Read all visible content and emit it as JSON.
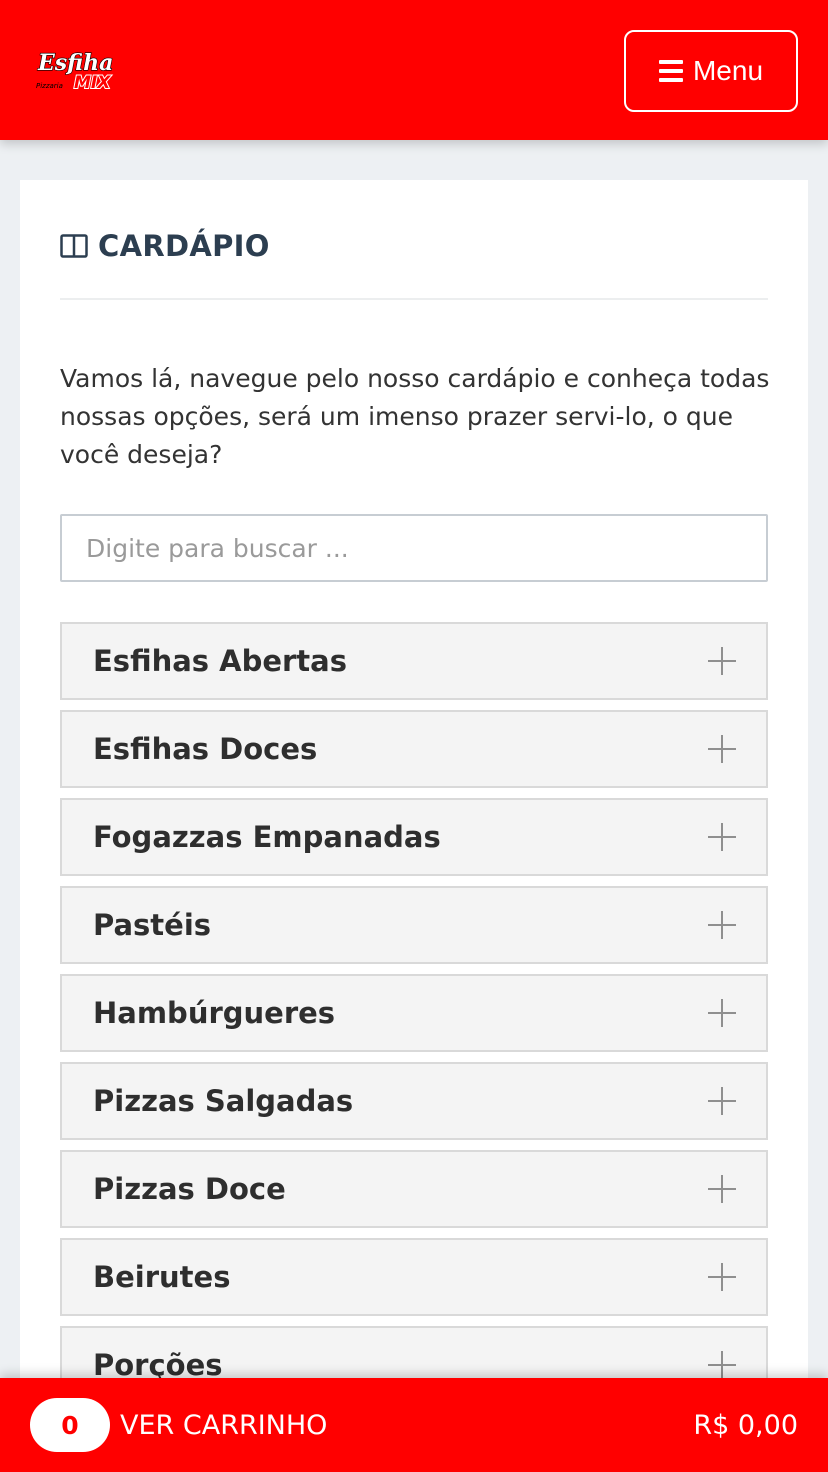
{
  "header": {
    "logo_alt": "Esfiha Mix Pizzaria",
    "logo_top": "Esfiha",
    "logo_small": "Pizzaria",
    "logo_bottom": "MIX",
    "menu_label": "Menu",
    "menu_icon": "hamburger-icon"
  },
  "main": {
    "title_icon": "book-open-icon",
    "title": "CARDÁPIO",
    "intro": "Vamos lá, navegue pelo nosso cardápio e conheça todas nossas opções, será um imenso prazer servi-lo, o que você deseja?",
    "search_placeholder": "Digite para buscar ..."
  },
  "categories": [
    {
      "label": "Esfihas Abertas"
    },
    {
      "label": "Esfihas Doces"
    },
    {
      "label": "Fogazzas Empanadas"
    },
    {
      "label": "Pastéis"
    },
    {
      "label": "Hambúrgueres"
    },
    {
      "label": "Pizzas Salgadas"
    },
    {
      "label": "Pizzas Doce"
    },
    {
      "label": "Beirutes"
    },
    {
      "label": "Porções"
    }
  ],
  "cart": {
    "count": "0",
    "label": "VER CARRINHO",
    "total": "R$ 0,00"
  },
  "colors": {
    "brand_red": "#ff0000",
    "title_navy": "#2c3e50",
    "category_bg": "#f4f4f4"
  }
}
